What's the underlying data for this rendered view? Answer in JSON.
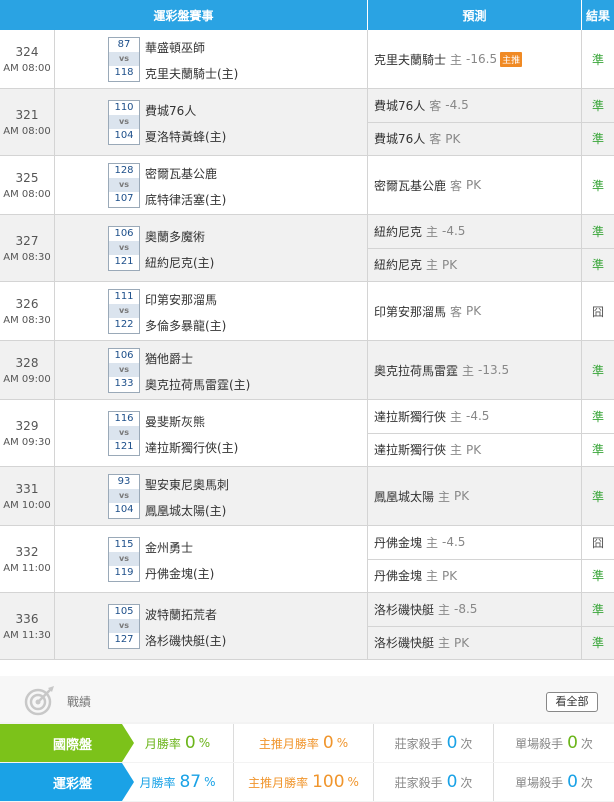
{
  "header": {
    "event": "運彩盤賽事",
    "prediction": "預測",
    "result": "結果"
  },
  "vs_label": "vs",
  "games": [
    {
      "id": "324",
      "time": "AM 08:00",
      "away_score": "87",
      "home_score": "118",
      "away": "華盛頓巫師",
      "home": "克里夫蘭騎士(主)",
      "preds": [
        {
          "team": "克里夫蘭騎士",
          "side": "主",
          "line": "-16.5",
          "badge": "主推",
          "result": "準"
        }
      ]
    },
    {
      "id": "321",
      "time": "AM 08:00",
      "away_score": "110",
      "home_score": "104",
      "away": "費城76人",
      "home": "夏洛特黃蜂(主)",
      "preds": [
        {
          "team": "費城76人",
          "side": "客",
          "line": "-4.5",
          "result": "準"
        },
        {
          "team": "費城76人",
          "side": "客",
          "line": "PK",
          "result": "準"
        }
      ]
    },
    {
      "id": "325",
      "time": "AM 08:00",
      "away_score": "128",
      "home_score": "107",
      "away": "密爾瓦基公鹿",
      "home": "底特律活塞(主)",
      "preds": [
        {
          "team": "密爾瓦基公鹿",
          "side": "客",
          "line": "PK",
          "result": "準"
        }
      ]
    },
    {
      "id": "327",
      "time": "AM 08:30",
      "away_score": "106",
      "home_score": "121",
      "away": "奧蘭多魔術",
      "home": "紐約尼克(主)",
      "preds": [
        {
          "team": "紐約尼克",
          "side": "主",
          "line": "-4.5",
          "result": "準"
        },
        {
          "team": "紐約尼克",
          "side": "主",
          "line": "PK",
          "result": "準"
        }
      ]
    },
    {
      "id": "326",
      "time": "AM 08:30",
      "away_score": "111",
      "home_score": "122",
      "away": "印第安那溜馬",
      "home": "多倫多暴龍(主)",
      "preds": [
        {
          "team": "印第安那溜馬",
          "side": "客",
          "line": "PK",
          "result": "囧"
        }
      ]
    },
    {
      "id": "328",
      "time": "AM 09:00",
      "away_score": "106",
      "home_score": "133",
      "away": "猶他爵士",
      "home": "奧克拉荷馬雷霆(主)",
      "preds": [
        {
          "team": "奧克拉荷馬雷霆",
          "side": "主",
          "line": "-13.5",
          "result": "準"
        }
      ]
    },
    {
      "id": "329",
      "time": "AM 09:30",
      "away_score": "116",
      "home_score": "121",
      "away": "曼斐斯灰熊",
      "home": "達拉斯獨行俠(主)",
      "preds": [
        {
          "team": "達拉斯獨行俠",
          "side": "主",
          "line": "-4.5",
          "result": "準"
        },
        {
          "team": "達拉斯獨行俠",
          "side": "主",
          "line": "PK",
          "result": "準"
        }
      ]
    },
    {
      "id": "331",
      "time": "AM 10:00",
      "away_score": "93",
      "home_score": "104",
      "away": "聖安東尼奧馬刺",
      "home": "鳳凰城太陽(主)",
      "preds": [
        {
          "team": "鳳凰城太陽",
          "side": "主",
          "line": "PK",
          "result": "準"
        }
      ]
    },
    {
      "id": "332",
      "time": "AM 11:00",
      "away_score": "115",
      "home_score": "119",
      "away": "金州勇士",
      "home": "丹佛金塊(主)",
      "preds": [
        {
          "team": "丹佛金塊",
          "side": "主",
          "line": "-4.5",
          "result": "囧"
        },
        {
          "team": "丹佛金塊",
          "side": "主",
          "line": "PK",
          "result": "準"
        }
      ]
    },
    {
      "id": "336",
      "time": "AM 11:30",
      "away_score": "105",
      "home_score": "127",
      "away": "波特蘭拓荒者",
      "home": "洛杉磯快艇(主)",
      "preds": [
        {
          "team": "洛杉磯快艇",
          "side": "主",
          "line": "-8.5",
          "result": "準"
        },
        {
          "team": "洛杉磯快艇",
          "side": "主",
          "line": "PK",
          "result": "準"
        }
      ]
    }
  ],
  "record": {
    "title": "戰績",
    "view_all": "看全部",
    "rows": [
      {
        "tag": "國際盤",
        "monthly_label": "月勝率",
        "monthly_value": "0",
        "monthly_unit": "%",
        "main_label": "主推月勝率",
        "main_value": "0",
        "main_unit": "%",
        "killer_label": "莊家殺手",
        "killer_value": "0",
        "killer_unit": "次",
        "single_label": "單場殺手",
        "single_value": "0",
        "single_unit": "次"
      },
      {
        "tag": "運彩盤",
        "monthly_label": "月勝率",
        "monthly_value": "87",
        "monthly_unit": "%",
        "main_label": "主推月勝率",
        "main_value": "100",
        "main_unit": "%",
        "killer_label": "莊家殺手",
        "killer_value": "0",
        "killer_unit": "次",
        "single_label": "單場殺手",
        "single_value": "0",
        "single_unit": "次"
      }
    ]
  },
  "colors": {
    "header": "#2aa3e3",
    "win": "#3aa63a",
    "badge": "#f08a24",
    "intl_tag": "#7cc21a",
    "lottery_tag": "#1aa2e6"
  }
}
